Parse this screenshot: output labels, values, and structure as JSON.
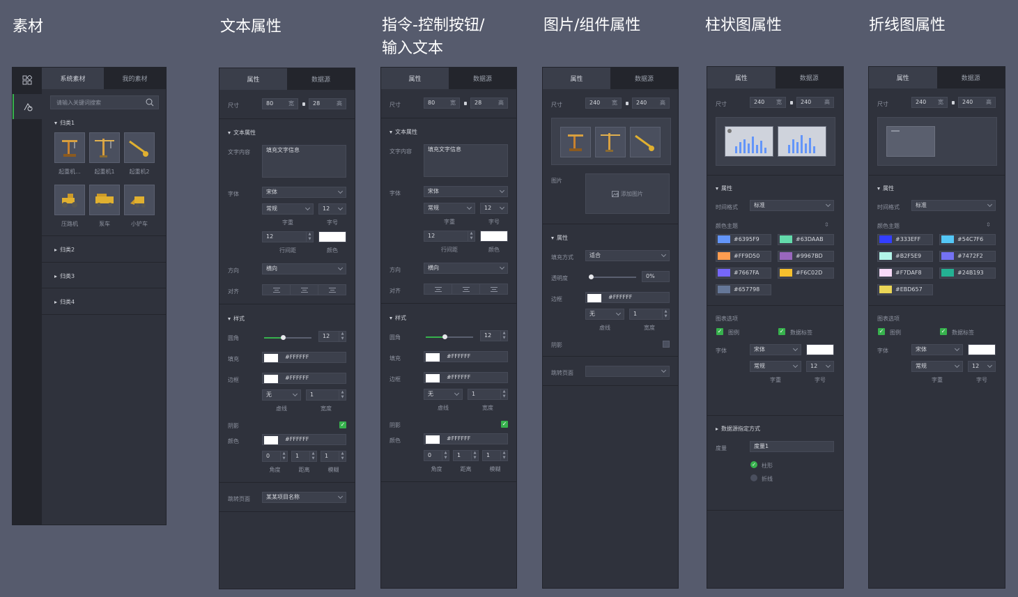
{
  "titles": {
    "assets": "素材",
    "text": "文本属性",
    "cmd_line1": "指令-控制按钮/",
    "cmd_line2": "输入文本",
    "image": "图片/组件属性",
    "bar": "柱状图属性",
    "line": "折线图属性"
  },
  "tabs": {
    "system": "系统素材",
    "mine": "我的素材",
    "props": "属性",
    "datasource": "数据源"
  },
  "assets": {
    "search_placeholder": "请输入关键词搜索",
    "cat1": "归类1",
    "cat2": "归类2",
    "cat3": "归类3",
    "cat4": "归类4",
    "items": [
      {
        "label": "起重机..."
      },
      {
        "label": "起重机1"
      },
      {
        "label": "起重机2"
      },
      {
        "label": "压路机"
      },
      {
        "label": "泵车"
      },
      {
        "label": "小铲车"
      }
    ]
  },
  "common": {
    "size": "尺寸",
    "w_unit": "宽",
    "h_unit": "高",
    "text_props": "文本属性",
    "text_content": "文字内容",
    "text_value": "填充文字信息",
    "font": "字体",
    "font_value": "宋体",
    "weight_value": "常规",
    "weight_cap": "字重",
    "size_value": "12",
    "size_cap": "字号",
    "line_h": "12",
    "line_h_cap": "行间距",
    "color_cap": "颜色",
    "direction": "方向",
    "direction_value": "横向",
    "align": "对齐",
    "style": "样式",
    "radius": "圆角",
    "radius_value": "12",
    "fill": "填充",
    "border": "边框",
    "white": "#FFFFFF",
    "dash_value": "无",
    "dash_cap": "虚线",
    "border_w": "1",
    "width_cap": "宽度",
    "shadow": "阴影",
    "color": "颜色",
    "angle": "0",
    "angle_cap": "角度",
    "dist": "1",
    "dist_cap": "距离",
    "blur": "1",
    "blur_cap": "模糊",
    "jump": "跳转页面",
    "jump_value": "某某项目名称",
    "check": "✓"
  },
  "text_panel": {
    "w": "80",
    "h": "28"
  },
  "image_panel": {
    "w": "240",
    "h": "240",
    "image": "图片",
    "add_image": "添加图片",
    "props": "属性",
    "fill_mode": "填充方式",
    "fill_mode_value": "适合",
    "opacity": "透明度",
    "opacity_value": "0%",
    "opacity_level": 0
  },
  "bar_panel": {
    "w": "240",
    "h": "240",
    "props": "属性",
    "time_format": "时间格式",
    "time_value": "标准",
    "theme": "颜色主题",
    "colors": [
      "#6395F9",
      "#63DAAB",
      "#FF9D50",
      "#9967BD",
      "#7667FA",
      "#F6C02D",
      "#657798"
    ],
    "options": "图表选项",
    "legend": "图例",
    "data_label": "数据标签",
    "font": "字体",
    "font_value": "宋体",
    "weight_value": "常规",
    "weight_cap": "字重",
    "size_value": "12",
    "size_cap": "字号",
    "ds_mode": "数据源指定方式",
    "measure": "度量",
    "measure_value": "度量1",
    "bar": "柱形",
    "line": "折线"
  },
  "line_panel": {
    "w": "240",
    "h": "240",
    "props": "属性",
    "time_format": "时间格式",
    "time_value": "标准",
    "theme": "颜色主题",
    "colors": [
      "#333EFF",
      "#54C7F6",
      "#B2F5E9",
      "#7472F2",
      "#F7DAF8",
      "#24B193",
      "#EBD657"
    ],
    "options": "图表选项",
    "legend": "图例",
    "data_label": "数据标签",
    "font": "字体",
    "font_value": "宋体",
    "weight_value": "常规",
    "weight_cap": "字重",
    "size_value": "12",
    "size_cap": "字号"
  },
  "colors_ui": {
    "panel": "#2f323c",
    "accent": "#37b24d"
  }
}
